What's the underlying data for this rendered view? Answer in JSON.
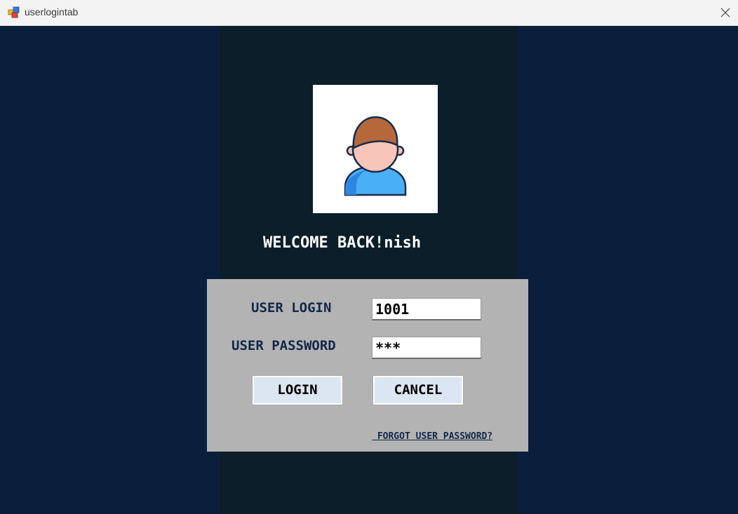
{
  "window": {
    "title": "userlogintab",
    "icon": "windows-form-icon",
    "close_icon": "close-icon"
  },
  "welcome": {
    "prefix": "WELCOME BACK!",
    "name": "nish"
  },
  "avatar": {
    "icon": "user-avatar-icon"
  },
  "form": {
    "login_label": "USER LOGIN",
    "login_value": "1001",
    "password_label": "USER PASSWORD",
    "password_value": "***",
    "login_button": "LOGIN",
    "cancel_button": "CANCEL",
    "forgot_link": " FORGOT USER PASSWORD?"
  },
  "colors": {
    "background": "#0b1f3d",
    "center_panel": "#0b1e2a",
    "form_panel": "#b3b3b3",
    "label_text": "#14274a",
    "button_face": "#dce6f2"
  }
}
